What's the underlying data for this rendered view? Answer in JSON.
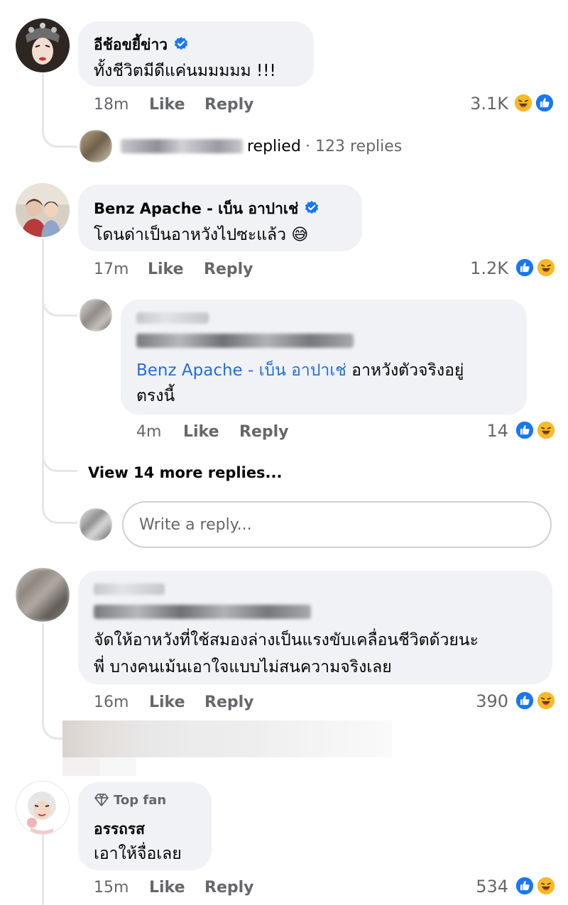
{
  "comments": [
    {
      "author": "อีช้อขยี้ข่าว",
      "verified": true,
      "text": "ทั้งชีวิตมีดีแค่นมมมมม !!!",
      "time": "18m",
      "like_label": "Like",
      "reply_label": "Reply",
      "reaction_count": "3.1K",
      "reactions": [
        "haha-icon",
        "like-icon"
      ],
      "replied_summary": {
        "verb": "replied",
        "count_text": "· 123 replies"
      }
    },
    {
      "author": "Benz Apache - เบ็น อาปาเช่",
      "verified": true,
      "text": "โดนด่าเป็นอาหวังไปซะแล้ว 😅",
      "time": "17m",
      "like_label": "Like",
      "reply_label": "Reply",
      "reaction_count": "1.2K",
      "reactions": [
        "like-icon",
        "haha-icon"
      ],
      "reply": {
        "mention": "Benz Apache - เบ็น อาปาเช่",
        "text_line1": " อาหวังตัวจริงอยู่",
        "text_line2": "ตรงนี้",
        "time": "4m",
        "like_label": "Like",
        "reply_label": "Reply",
        "reaction_count": "14",
        "reactions": [
          "like-icon",
          "haha-icon"
        ]
      },
      "view_more": "View 14 more replies...",
      "write_reply_placeholder": "Write a reply..."
    },
    {
      "text_line1": "จัดให้อาหวังที่ใช้สมองล่างเป็นแรงขับเคลื่อนชีวิตด้วยนะ",
      "text_line2": "พี่ บางคนเม้นเอาใจแบบไม่สนความจริงเลย",
      "time": "16m",
      "like_label": "Like",
      "reply_label": "Reply",
      "reaction_count": "390",
      "reactions": [
        "like-icon",
        "haha-icon"
      ]
    },
    {
      "badge": "Top fan",
      "author": "อรรถรส",
      "text": "เอาให้จื่อเลย",
      "time": "15m",
      "like_label": "Like",
      "reply_label": "Reply",
      "reaction_count": "534",
      "reactions": [
        "like-icon",
        "haha-icon"
      ]
    }
  ],
  "colors": {
    "bubble": "#f0f2f5",
    "meta_text": "#65676b",
    "link": "#216fdb",
    "like_blue": "#1877f2",
    "haha_yellow": "#f7b928"
  }
}
